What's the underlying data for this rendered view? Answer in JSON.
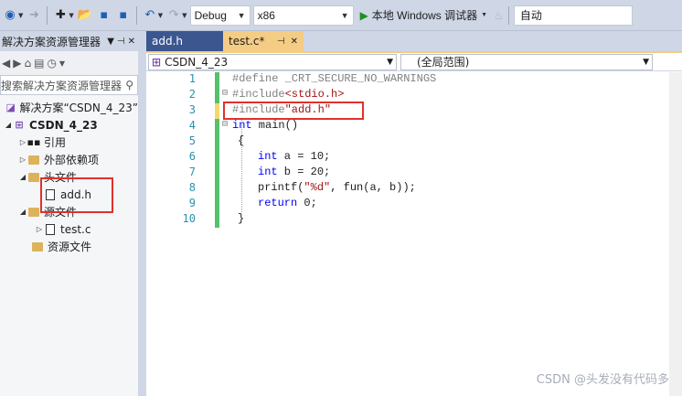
{
  "toolbar": {
    "config": "Debug",
    "platform": "x86",
    "run_label": "本地 Windows 调试器",
    "auto_label": "自动"
  },
  "solution_explorer": {
    "title": "解决方案资源管理器",
    "search_placeholder": "搜索解决方案资源管理器",
    "solution_label": "解决方案“CSDN_4_23”",
    "project": "CSDN_4_23",
    "nodes": [
      "引用",
      "外部依赖项",
      "头文件",
      "add.h",
      "源文件",
      "test.c",
      "资源文件"
    ]
  },
  "editor": {
    "tabs": [
      {
        "label": "add.h",
        "active": false
      },
      {
        "label": "test.c*",
        "active": true
      }
    ],
    "scope_project": "CSDN_4_23",
    "scope_global": "(全局范围)",
    "line_numbers": [
      "1",
      "2",
      "3",
      "4",
      "5",
      "6",
      "7",
      "8",
      "9",
      "10"
    ],
    "code": {
      "l1": "#define _CRT_SECURE_NO_WARNINGS",
      "l2a": "#include",
      "l2b": "<stdio.h>",
      "l3a": "#include",
      "l3b": "\"add.h\"",
      "l4a": "int",
      "l4b": " main()",
      "l5": "{",
      "l6a": "int",
      "l6b": " a = 10;",
      "l7a": "int",
      "l7b": " b = 20;",
      "l8a": "printf(",
      "l8b": "\"%d\"",
      "l8c": ", fun(a, b));",
      "l9a": "return",
      "l9b": " 0;",
      "l10": "}"
    }
  },
  "watermark": "CSDN @头发没有代码多"
}
